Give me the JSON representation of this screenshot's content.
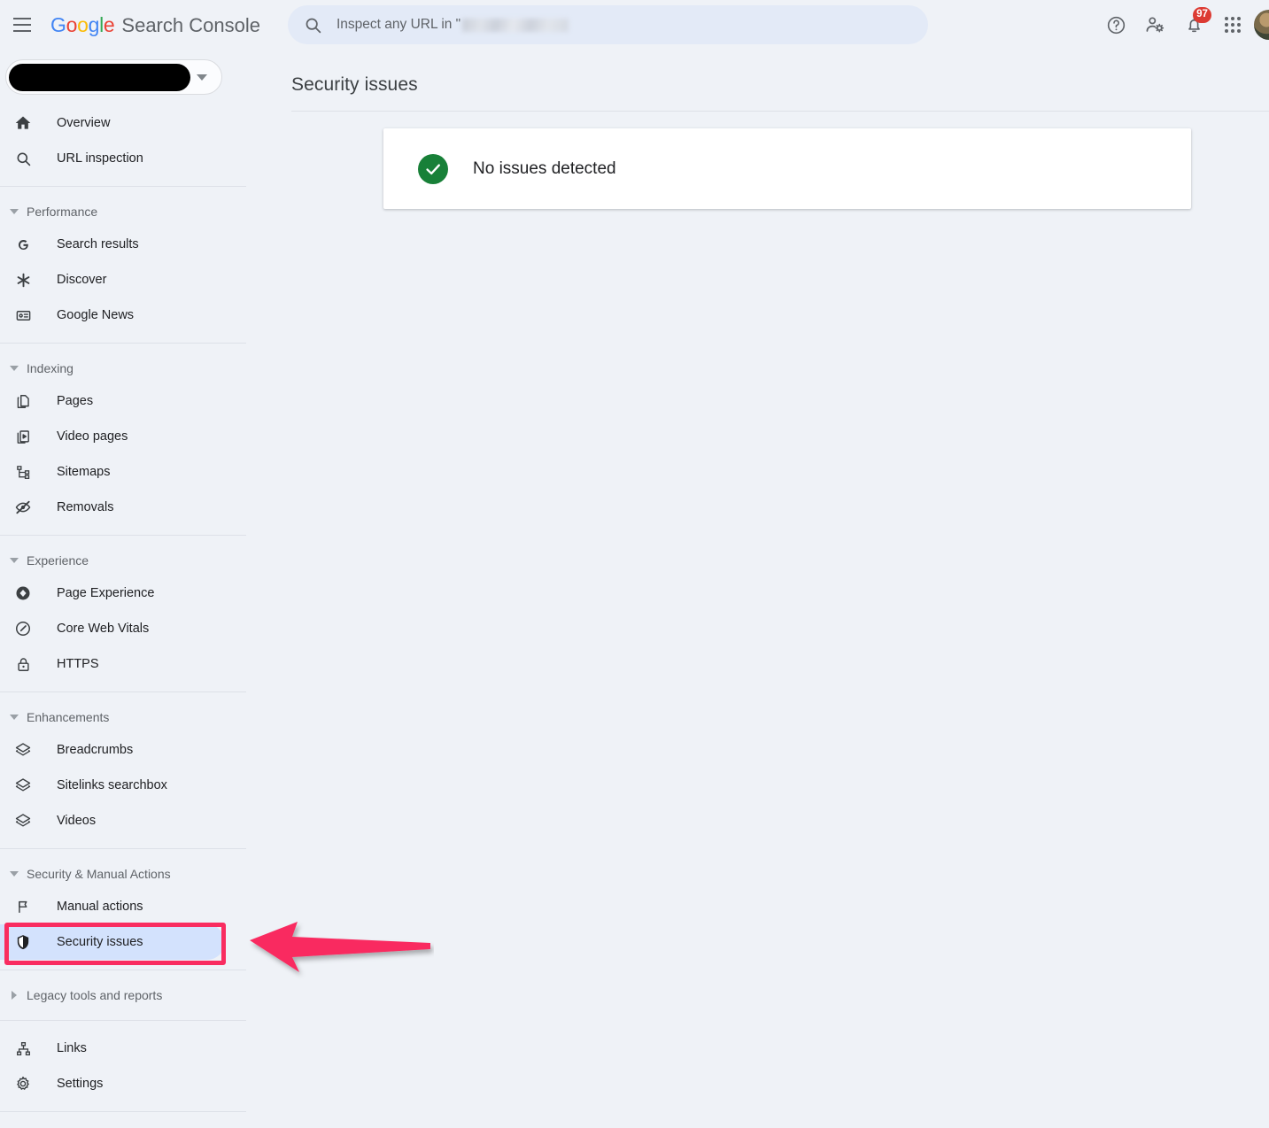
{
  "app": {
    "brand_google": "Google",
    "brand_suffix": "Search Console",
    "menu_icon": "hamburger-icon"
  },
  "search": {
    "placeholder_prefix": "Inspect any URL in \"",
    "icon": "search-icon",
    "value_redacted": true
  },
  "topbar": {
    "help_icon": "help-circle-icon",
    "user_settings_icon": "user-settings-icon",
    "notifications_icon": "bell-icon",
    "notifications_count": "97",
    "apps_icon": "apps-grid-icon",
    "avatar": "user-avatar",
    "badge_color": "#dc3b33"
  },
  "property_selector": {
    "label_redacted": true,
    "chevron_icon": "chevron-down-icon"
  },
  "sidebar": {
    "top_items": [
      {
        "label": "Overview",
        "icon": "home-icon"
      },
      {
        "label": "URL inspection",
        "icon": "search-icon"
      }
    ],
    "sections": [
      {
        "title": "Performance",
        "expanded": true,
        "items": [
          {
            "label": "Search results",
            "icon": "google-g-icon"
          },
          {
            "label": "Discover",
            "icon": "asterisk-icon"
          },
          {
            "label": "Google News",
            "icon": "news-card-icon"
          }
        ]
      },
      {
        "title": "Indexing",
        "expanded": true,
        "items": [
          {
            "label": "Pages",
            "icon": "copy-pages-icon"
          },
          {
            "label": "Video pages",
            "icon": "video-page-icon"
          },
          {
            "label": "Sitemaps",
            "icon": "sitemap-icon"
          },
          {
            "label": "Removals",
            "icon": "eye-off-icon"
          }
        ]
      },
      {
        "title": "Experience",
        "expanded": true,
        "items": [
          {
            "label": "Page Experience",
            "icon": "diamond-circle-icon"
          },
          {
            "label": "Core Web Vitals",
            "icon": "speedometer-icon"
          },
          {
            "label": "HTTPS",
            "icon": "lock-icon"
          }
        ]
      },
      {
        "title": "Enhancements",
        "expanded": true,
        "items": [
          {
            "label": "Breadcrumbs",
            "icon": "layers-icon"
          },
          {
            "label": "Sitelinks searchbox",
            "icon": "layers-icon"
          },
          {
            "label": "Videos",
            "icon": "layers-icon"
          }
        ]
      },
      {
        "title": "Security & Manual Actions",
        "expanded": true,
        "items": [
          {
            "label": "Manual actions",
            "icon": "flag-icon"
          },
          {
            "label": "Security issues",
            "icon": "shield-icon",
            "active": true
          }
        ]
      }
    ],
    "legacy": {
      "title": "Legacy tools and reports",
      "expanded": false
    },
    "bottom_items": [
      {
        "label": "Links",
        "icon": "links-graph-icon"
      },
      {
        "label": "Settings",
        "icon": "gear-icon"
      }
    ],
    "active_item_bg": "#d3e2fd"
  },
  "main": {
    "page_title": "Security issues",
    "status_card": {
      "text": "No issues detected",
      "icon": "check-circle-icon",
      "icon_color": "#188038"
    }
  },
  "annotations": {
    "highlight_color": "#f92c60",
    "highlight_target": "Security issues",
    "arrow_direction": "left",
    "arrow_color": "#f92c60"
  }
}
